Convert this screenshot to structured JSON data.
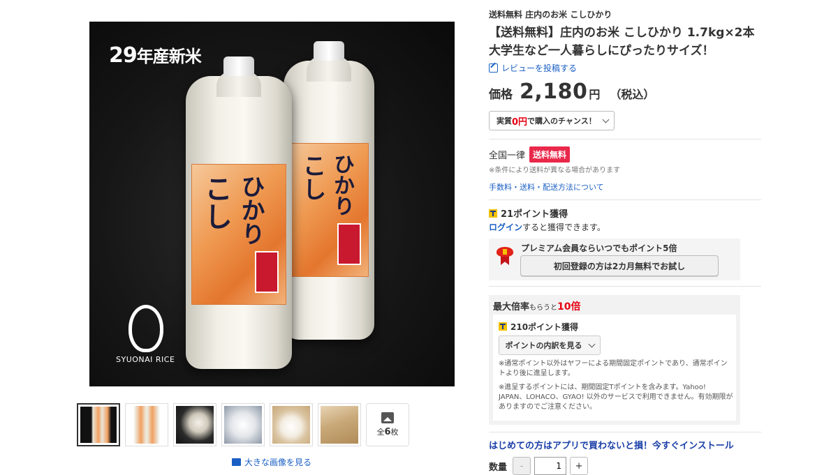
{
  "product_image": {
    "badge_year": "29",
    "badge_text": "年産新米",
    "logo_text": "SYUONAI RICE",
    "label_kanji_left": "こし",
    "label_kanji_right": "ひかり"
  },
  "thumbnails": {
    "count": 6,
    "more_label": "全",
    "more_count": "6",
    "more_unit": "枚"
  },
  "big_image_link": "大きな画像を見る",
  "store_name": "送料無料 庄内のお米 こしひかり",
  "title": "【送料無料】庄内のお米 こしひかり 1.7kg×2本 大学生など一人暮らしにぴったりサイズ！",
  "review_link": "レビューを投稿する",
  "price": {
    "label": "価格",
    "value": "2,180",
    "yen": "円",
    "tax": "（税込）"
  },
  "chance": {
    "prefix": "実質",
    "amount": "0円",
    "suffix": "で購入のチャンス！"
  },
  "shipping": {
    "region": "全国一律",
    "badge": "送料無料",
    "note": "※条件により送料が異なる場合があります",
    "link": "手数料・送料・配送方法について"
  },
  "points": {
    "earn": "21ポイント獲得",
    "login_link": "ログイン",
    "login_rest": "すると獲得できます。",
    "premium_text": "プレミアム会員ならいつでもポイント5倍",
    "trial_button": "初回登録の方は2カ月無料でお試し"
  },
  "max_rate": {
    "title": "最大倍率",
    "small": "もらうと",
    "rate": "10倍",
    "points": "210ポイント獲得",
    "breakdown_button": "ポイントの内訳を見る",
    "note1": "※通常ポイント以外はヤフーによる期間固定ポイントであり、通常ポイントより後に進呈します。",
    "note2": "※進呈するポイントには、期間固定Tポイントを含みます。Yahoo! JAPAN、LOHACO、GYAO! 以外のサービスで利用できません。有効期限がありますのでご注意ください。"
  },
  "app_banner": "はじめての方はアプリで買わないと損！今すぐインストール",
  "quantity": {
    "label": "数量",
    "minus": "-",
    "value": "1",
    "plus": "+"
  },
  "colors": {
    "link": "#1a5fc4",
    "red": "#e60012",
    "badge_pink": "#e9284a",
    "tpoint_yellow": "#f4c200"
  }
}
